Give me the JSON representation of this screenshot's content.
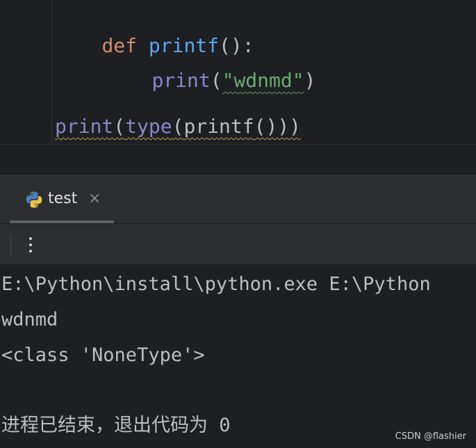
{
  "colors": {
    "editor_bg": "#1e1f22",
    "panel_bg": "#2b2d30",
    "keyword": "#cf8e6d",
    "function_def": "#56a8f5",
    "builtin": "#8888c6",
    "string": "#6aab73",
    "text": "#bcbec4"
  },
  "editor": {
    "line1": {
      "kw": "def",
      "name": "printf",
      "tail": "():"
    },
    "line2": {
      "builtin": "print",
      "open": "(",
      "string": "\"wdnmd\"",
      "close": ")"
    },
    "line4": {
      "print": "print",
      "p1": "(",
      "type": "type",
      "p2": "(",
      "printf": "printf",
      "tail": "()))"
    }
  },
  "run_panel": {
    "tab": {
      "label": "test",
      "icon": "python-icon",
      "close_icon": "close-icon",
      "close_glyph": "×"
    },
    "toolbar": {
      "more_icon": "more-vertical-icon"
    }
  },
  "console": {
    "lines": [
      "E:\\Python\\install\\python.exe E:\\Python",
      "wdnmd",
      "<class 'NoneType'>",
      "",
      "进程已结束，退出代码为 0"
    ]
  },
  "watermark": "CSDN @flashier"
}
